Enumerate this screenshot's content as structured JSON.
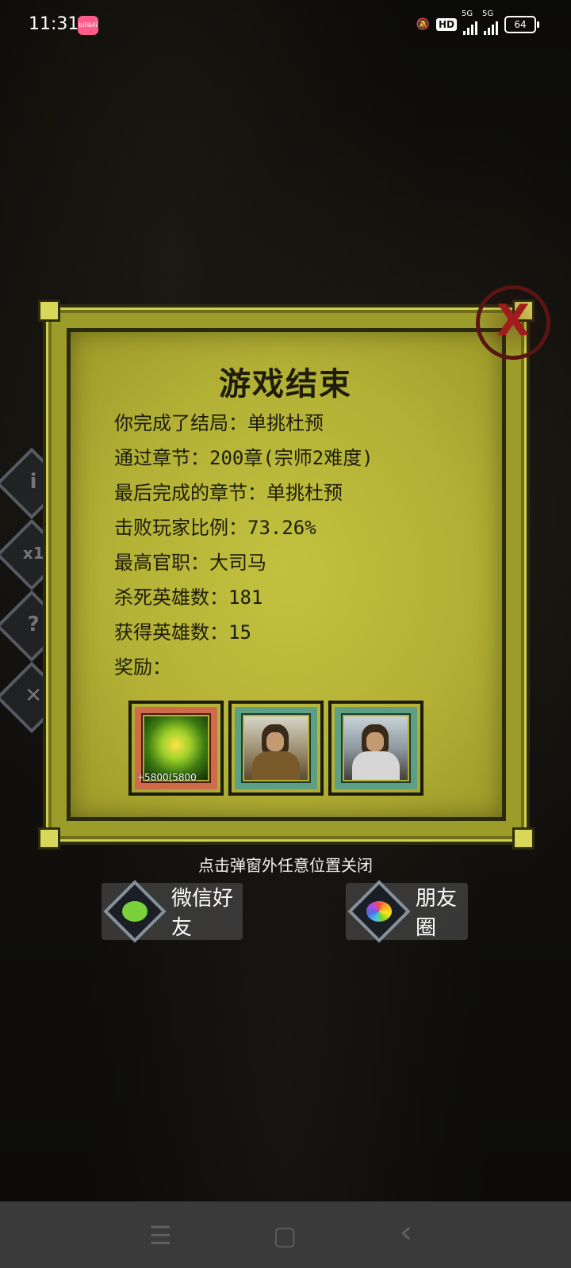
{
  "status_bar": {
    "time": "11:31",
    "app_badge": "bilibili",
    "hd_label": "HD",
    "signal_1_label": "5G",
    "signal_2_label": "5G",
    "battery": "64"
  },
  "side_buttons": [
    {
      "icon": "info-icon",
      "glyph": "i"
    },
    {
      "icon": "speed-icon",
      "glyph": "x1"
    },
    {
      "icon": "help-icon",
      "glyph": "?"
    },
    {
      "icon": "close-icon",
      "glyph": "✕"
    }
  ],
  "dialog": {
    "title": "游戏结束",
    "lines": [
      "你完成了结局：单挑杜预",
      "通过章节：200章(宗师2难度)",
      "最后完成的章节：单挑杜预",
      "击败玩家比例：73.26%",
      "最高官职：大司马",
      "杀死英雄数：181",
      "获得英雄数：15",
      "奖励："
    ],
    "rewards": [
      {
        "type": "orb",
        "label": "+5800(5800",
        "frame_color": "#cf6b4b"
      },
      {
        "type": "hero",
        "label": "",
        "frame_color": "#5c9f84"
      },
      {
        "type": "hero",
        "label": "",
        "frame_color": "#5c9f84"
      }
    ],
    "close_glyph": "X"
  },
  "hint": "点击弹窗外任意位置关闭",
  "share": {
    "wechat_label": "微信好友",
    "moments_label": "朋友圈"
  },
  "nav": {
    "menu_glyph": "☰",
    "home_glyph": "▢",
    "back_glyph": "‹"
  }
}
